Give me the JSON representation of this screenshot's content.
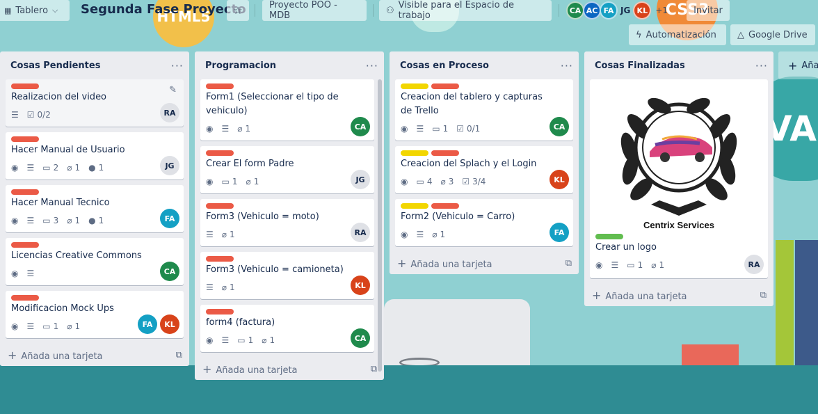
{
  "colors": {
    "label_red": "#eb5a46",
    "label_yellow": "#f2d600",
    "label_green": "#61bd4f",
    "avatar_CA": "#1f8a4c",
    "avatar_AC": "#0c66c2",
    "avatar_FA": "#14a0c4",
    "avatar_KL": "#d8431a",
    "avatar_RA": "#dfe1e6",
    "avatar_JG": "#dfe1e6"
  },
  "header": {
    "board_menu": "Tablero",
    "board_title": "Segunda Fase Proyecto",
    "team": "Proyecto POO - MDB",
    "visibility": "Visible para el Espacio de trabajo",
    "members": [
      "CA",
      "AC",
      "FA"
    ],
    "member_plain": "JG",
    "member_kl": "KL",
    "more_members": "+1",
    "invite": "Invitar",
    "automation": "Automatización",
    "drive": "Google Drive"
  },
  "add_card_label": "Añada una tarjeta",
  "add_list_label": "Aña",
  "lists": [
    {
      "title": "Cosas Pendientes",
      "cards": [
        {
          "title": "Realizacion del video",
          "checklist": "0/2",
          "member": "RA"
        },
        {
          "title": "Hacer Manual de Usuario",
          "comments": "2",
          "attachments": "1",
          "github": "1",
          "member": "JG"
        },
        {
          "title": "Hacer Manual Tecnico",
          "comments": "3",
          "attachments": "1",
          "github": "1",
          "member": "FA"
        },
        {
          "title": "Licencias Creative Commons",
          "member": "CA"
        },
        {
          "title": "Modificacion Mock Ups",
          "comments": "1",
          "attachments": "1",
          "members": [
            "FA",
            "KL"
          ]
        }
      ]
    },
    {
      "title": "Programacion",
      "cards": [
        {
          "title": "Form1 (Seleccionar el tipo de vehiculo)",
          "attachments": "1",
          "member": "CA"
        },
        {
          "title": "Crear El form Padre",
          "comments": "1",
          "attachments": "1",
          "member": "JG"
        },
        {
          "title": "Form3 (Vehiculo = moto)",
          "attachments": "1",
          "member": "RA"
        },
        {
          "title": "Form3 (Vehiculo = camioneta)",
          "attachments": "1",
          "member": "KL"
        },
        {
          "title": "form4 (factura)",
          "comments": "1",
          "attachments": "1",
          "member": "CA"
        }
      ]
    },
    {
      "title": "Cosas en Proceso",
      "cards": [
        {
          "title": "Creacion del tablero y capturas de Trello",
          "comments": "1",
          "checklist": "0/1",
          "member": "CA"
        },
        {
          "title": "Creacion del Splach y el Login",
          "comments": "4",
          "attachments": "3",
          "checklist": "3/4",
          "member": "KL"
        },
        {
          "title": "Form2 (Vehiculo = Carro)",
          "attachments": "1",
          "member": "FA"
        }
      ]
    },
    {
      "title": "Cosas Finalizadas",
      "cards": [
        {
          "title": "Crear un logo",
          "logo_caption": "Centrix Services",
          "comments": "1",
          "attachments": "1",
          "member": "RA"
        }
      ]
    }
  ],
  "menu_glyph": "···"
}
